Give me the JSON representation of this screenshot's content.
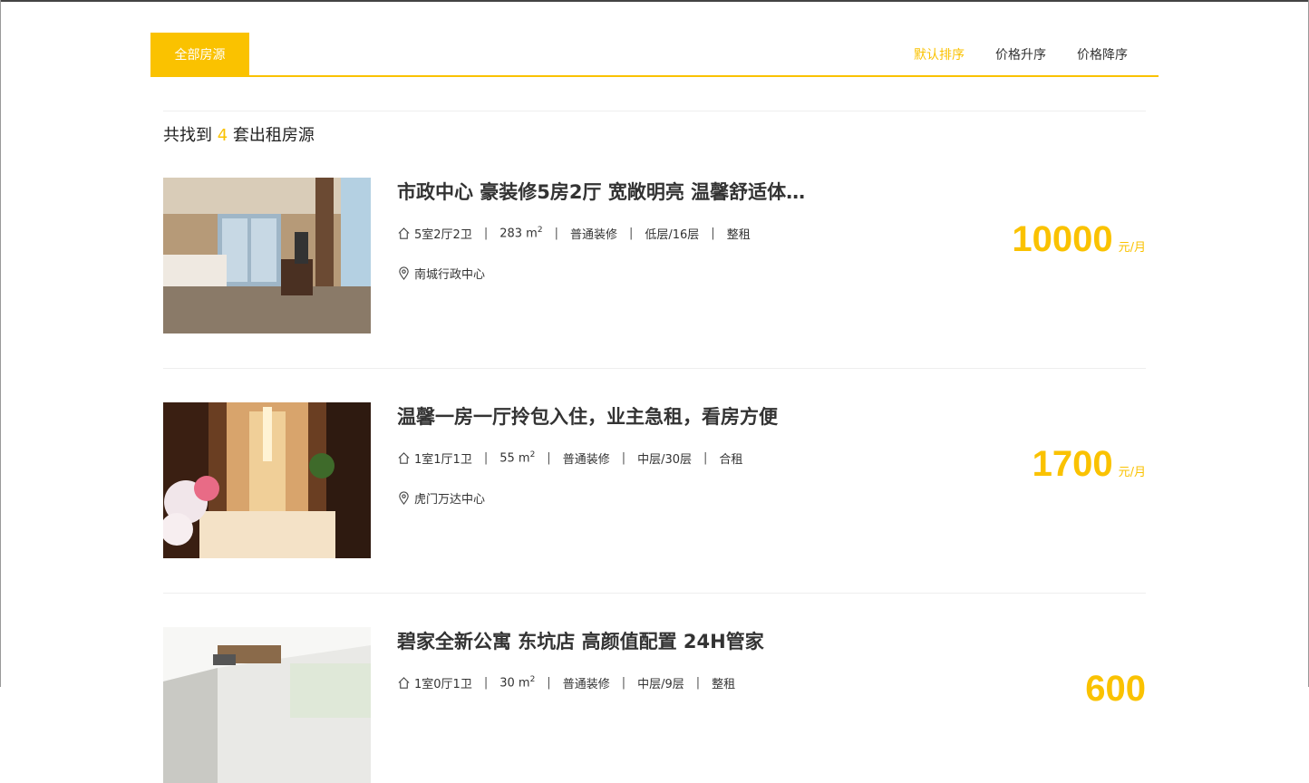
{
  "tabs": {
    "all_label": "全部房源"
  },
  "sort": {
    "default": "默认排序",
    "asc": "价格升序",
    "desc": "价格降序"
  },
  "summary": {
    "prefix": "共找到 ",
    "count": "4",
    "suffix": " 套出租房源"
  },
  "colors": {
    "accent": "#fac200",
    "text": "#333333"
  },
  "listings": [
    {
      "title": "市政中心 豪装修5房2厅 宽敞明亮 温馨舒适体…",
      "layout": "5室2厅2卫",
      "area": "283 m",
      "area_unit": "2",
      "decoration": "普通装修",
      "floor": "低层/16层",
      "rent_type": "整租",
      "location": "南城行政中心",
      "price": "10000",
      "price_unit": "元/月"
    },
    {
      "title": "温馨一房一厅拎包入住，业主急租，看房方便",
      "layout": "1室1厅1卫",
      "area": "55 m",
      "area_unit": "2",
      "decoration": "普通装修",
      "floor": "中层/30层",
      "rent_type": "合租",
      "location": "虎门万达中心",
      "price": "1700",
      "price_unit": "元/月"
    },
    {
      "title": "碧家全新公寓 东坑店 高颜值配置 24H管家",
      "layout": "1室0厅1卫",
      "area": "30 m",
      "area_unit": "2",
      "decoration": "普通装修",
      "floor": "中层/9层",
      "rent_type": "整租",
      "price": "600"
    }
  ]
}
